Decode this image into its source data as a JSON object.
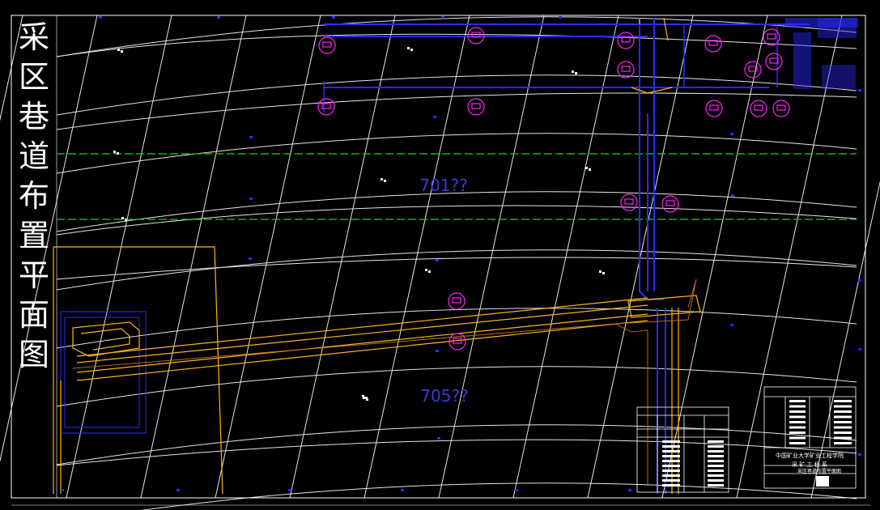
{
  "drawing": {
    "title_chars": [
      "采",
      "区",
      "巷",
      "道",
      "布",
      "置",
      "平",
      "面",
      "图"
    ],
    "labels": {
      "panel_upper": "701??",
      "panel_lower": "705??"
    },
    "colors": {
      "background": "#000000",
      "frame": "#ffffff",
      "grid": "#ffffff",
      "roadway_blue": "#2a2aff",
      "roadway_orange": "#ffb21a",
      "symbol_magenta": "#ff22ff",
      "boundary_green": "#22cc22",
      "label_blue": "#3a3ad8"
    },
    "title_block": {
      "institution": "中国矿业大学矿业工程学院",
      "department": "采 矿 工 程 系",
      "drawing_name": "采区巷道布置平面图"
    }
  }
}
